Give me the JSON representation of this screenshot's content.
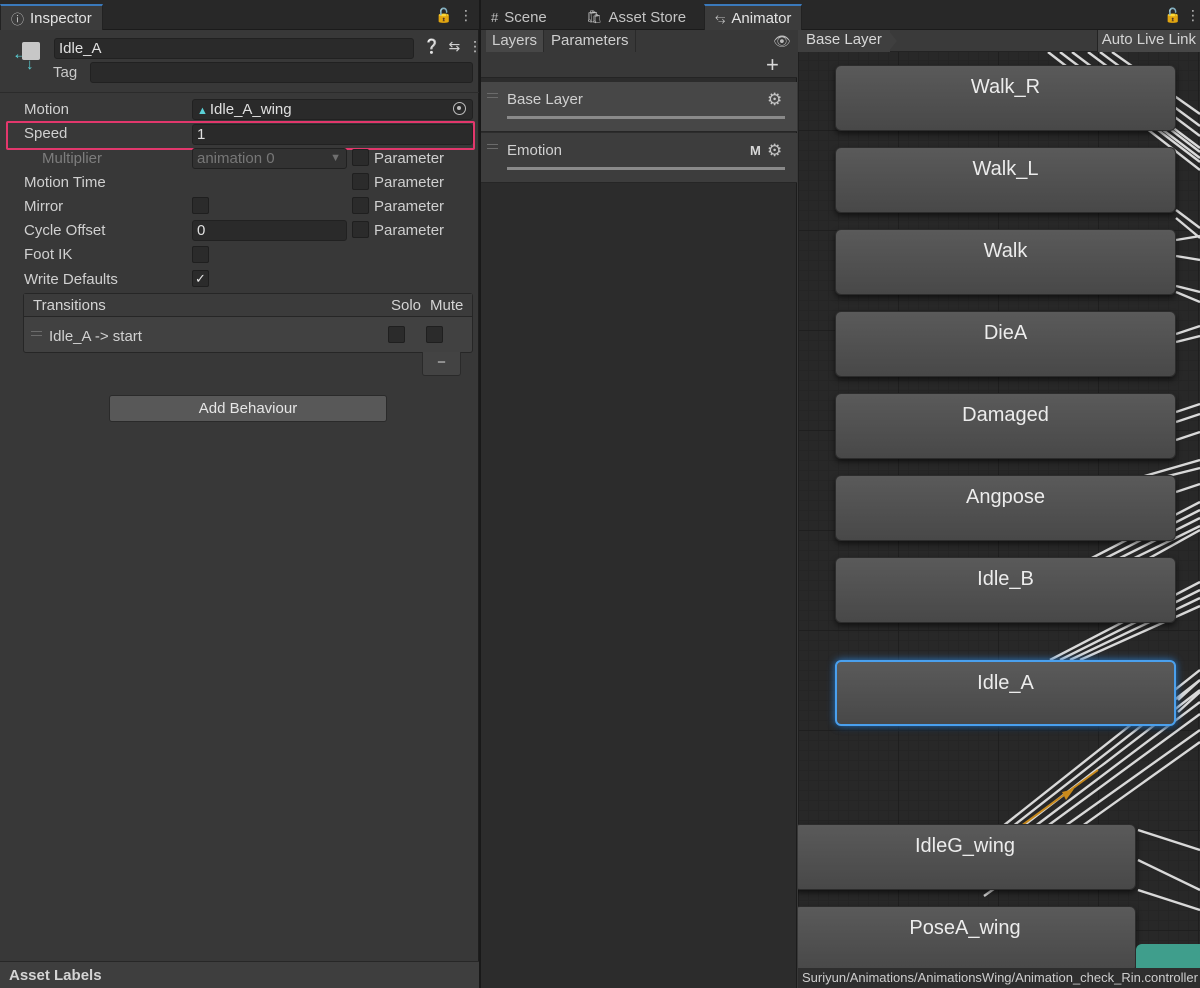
{
  "inspector": {
    "tab_label": "Inspector",
    "object_name": "Idle_A",
    "tag_label": "Tag",
    "tag_value": "",
    "rows": {
      "motion_label": "Motion",
      "motion_value": "Idle_A_wing",
      "speed_label": "Speed",
      "speed_value": "1",
      "multiplier_label": "Multiplier",
      "multiplier_value": "animation 0",
      "motion_time_label": "Motion Time",
      "mirror_label": "Mirror",
      "cycle_offset_label": "Cycle Offset",
      "cycle_offset_value": "0",
      "foot_ik_label": "Foot IK",
      "write_defaults_label": "Write Defaults",
      "parameter_label": "Parameter"
    },
    "write_defaults_checked": true,
    "transitions": {
      "header": "Transitions",
      "solo": "Solo",
      "mute": "Mute",
      "items": [
        "Idle_A -> start"
      ],
      "remove_label": "−"
    },
    "add_behaviour": "Add Behaviour",
    "asset_labels": "Asset Labels"
  },
  "tabs": {
    "scene": "Scene",
    "asset_store": "Asset Store",
    "animator": "Animator"
  },
  "animator": {
    "layers_tab": "Layers",
    "parameters_tab": "Parameters",
    "layers": [
      {
        "name": "Base Layer"
      },
      {
        "name": "Emotion",
        "flag": "M"
      }
    ],
    "breadcrumb": "Base Layer",
    "auto_live_link": "Auto Live Link",
    "states": [
      "Walk_R",
      "Walk_L",
      "Walk",
      "DieA",
      "Damaged",
      "Angpose",
      "Idle_B",
      "Idle_A",
      "IdleG_wing",
      "PoseA_wing"
    ],
    "selected_state": "Idle_A",
    "status_path": "Suriyun/Animations/AnimationsWing/Animation_check_Rin.controller"
  },
  "colors": {
    "highlight_box": "#e2376c",
    "selection_glow": "#4aa0ee",
    "active_transition": "#c98a1b",
    "motion_icon": "#5ad0d6"
  }
}
